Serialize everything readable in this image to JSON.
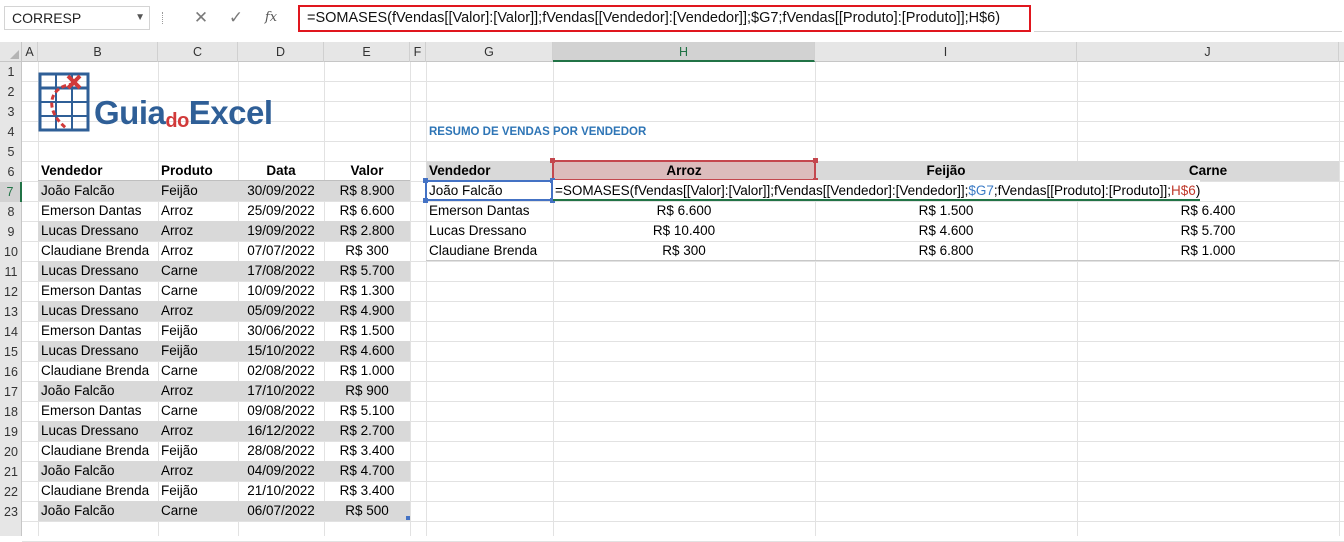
{
  "formula_bar": {
    "name_box": "CORRESP",
    "cancel_symbol": "✕",
    "enter_symbol": "✓",
    "fx_label": "fx",
    "formula": "=SOMASES(fVendas[[Valor]:[Valor]];fVendas[[Vendedor]:[Vendedor]];$G7;fVendas[[Produto]:[Produto]];H$6)"
  },
  "columns": [
    "A",
    "B",
    "C",
    "D",
    "E",
    "F",
    "G",
    "H",
    "I",
    "J"
  ],
  "rows": [
    "1",
    "2",
    "3",
    "4",
    "5",
    "6",
    "7",
    "8",
    "9",
    "10",
    "11",
    "12",
    "13",
    "14",
    "15",
    "16",
    "17",
    "18",
    "19",
    "20",
    "21",
    "22",
    "23"
  ],
  "active_cell": "H7",
  "logo": {
    "text_guia": "Guia",
    "text_do": "do",
    "text_excel": "Excel"
  },
  "sales_table": {
    "headers": [
      "Vendedor",
      "Produto",
      "Data",
      "Valor"
    ],
    "rows": [
      [
        "João Falcão",
        "Feijão",
        "30/09/2022",
        "R$ 8.900"
      ],
      [
        "Emerson Dantas",
        "Arroz",
        "25/09/2022",
        "R$ 6.600"
      ],
      [
        "Lucas Dressano",
        "Arroz",
        "19/09/2022",
        "R$ 2.800"
      ],
      [
        "Claudiane Brenda",
        "Arroz",
        "07/07/2022",
        "R$ 300"
      ],
      [
        "Lucas Dressano",
        "Carne",
        "17/08/2022",
        "R$ 5.700"
      ],
      [
        "Emerson Dantas",
        "Carne",
        "10/09/2022",
        "R$ 1.300"
      ],
      [
        "Lucas Dressano",
        "Arroz",
        "05/09/2022",
        "R$ 4.900"
      ],
      [
        "Emerson Dantas",
        "Feijão",
        "30/06/2022",
        "R$ 1.500"
      ],
      [
        "Lucas Dressano",
        "Feijão",
        "15/10/2022",
        "R$ 4.600"
      ],
      [
        "Claudiane Brenda",
        "Carne",
        "02/08/2022",
        "R$ 1.000"
      ],
      [
        "João Falcão",
        "Arroz",
        "17/10/2022",
        "R$ 900"
      ],
      [
        "Emerson Dantas",
        "Carne",
        "09/08/2022",
        "R$ 5.100"
      ],
      [
        "Lucas Dressano",
        "Arroz",
        "16/12/2022",
        "R$ 2.700"
      ],
      [
        "Claudiane Brenda",
        "Feijão",
        "28/08/2022",
        "R$ 3.400"
      ],
      [
        "João Falcão",
        "Arroz",
        "04/09/2022",
        "R$ 4.700"
      ],
      [
        "Claudiane Brenda",
        "Feijão",
        "21/10/2022",
        "R$ 3.400"
      ],
      [
        "João Falcão",
        "Carne",
        "06/07/2022",
        "R$ 500"
      ]
    ]
  },
  "summary": {
    "title": "RESUMO DE VENDAS POR VENDEDOR",
    "headers": [
      "Vendedor",
      "Arroz",
      "Feijão",
      "Carne"
    ],
    "editing_cell": {
      "vendor": "João Falcão",
      "formula_part1": "=SOMASES(fVendas[[Valor]:[Valor]];fVendas[[Vendedor]:[Vendedor]];",
      "formula_ref_g7": "$G7",
      "formula_part2": ";fVendas[[Produto]:[Produto]];",
      "formula_ref_h6": "H$6",
      "formula_end": ")"
    },
    "rows": [
      [
        "Emerson Dantas",
        "R$ 6.600",
        "R$ 1.500",
        "R$ 6.400"
      ],
      [
        "Lucas Dressano",
        "R$ 10.400",
        "R$ 4.600",
        "R$ 5.700"
      ],
      [
        "Claudiane Brenda",
        "R$ 300",
        "R$ 6.800",
        "R$ 1.000"
      ]
    ]
  },
  "colors": {
    "formula_highlight_border": "#e0161e",
    "table_band": "#d9d9d9",
    "excel_green": "#217346",
    "ref_blue": "#3b7bc6",
    "ref_red": "#c0392b",
    "title_blue": "#2e75b6",
    "logo_blue": "#2f5f97",
    "logo_red": "#d13a3a"
  }
}
